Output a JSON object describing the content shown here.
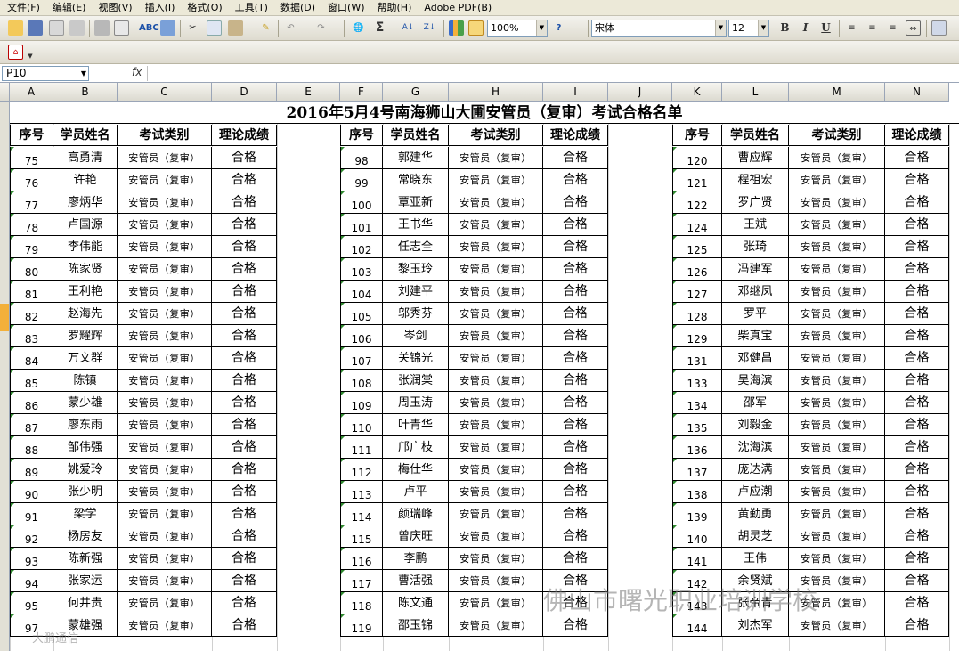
{
  "menu": [
    "文件(F)",
    "编辑(E)",
    "视图(V)",
    "插入(I)",
    "格式(O)",
    "工具(T)",
    "数据(D)",
    "窗口(W)",
    "帮助(H)",
    "Adobe PDF(B)"
  ],
  "toolbar": {
    "zoom": "100%",
    "font": "宋体",
    "size": "12",
    "bold": "B",
    "italic": "I",
    "underline": "U"
  },
  "formula": {
    "cell_ref": "P10",
    "fx": "fx",
    "value": ""
  },
  "columns": [
    "A",
    "B",
    "C",
    "D",
    "E",
    "F",
    "G",
    "H",
    "I",
    "J",
    "K",
    "L",
    "M",
    "N"
  ],
  "title": "2016年5月4号南海狮山大圃安管员（复审）考试合格名单",
  "headers": {
    "no": "序号",
    "name": "学员姓名",
    "type": "考试类别",
    "result": "理论成绩"
  },
  "type_value": "安管员（复审）",
  "result_value": "合格",
  "groups": [
    {
      "rows": [
        {
          "no": "75",
          "name": "高勇清"
        },
        {
          "no": "76",
          "name": "许艳"
        },
        {
          "no": "77",
          "name": "廖炳华"
        },
        {
          "no": "78",
          "name": "卢国源"
        },
        {
          "no": "79",
          "name": "李伟能"
        },
        {
          "no": "80",
          "name": "陈家贤"
        },
        {
          "no": "81",
          "name": "王利艳"
        },
        {
          "no": "82",
          "name": "赵海先"
        },
        {
          "no": "83",
          "name": "罗耀辉"
        },
        {
          "no": "84",
          "name": "万文群"
        },
        {
          "no": "85",
          "name": "陈镇"
        },
        {
          "no": "86",
          "name": "蒙少雄"
        },
        {
          "no": "87",
          "name": "廖东雨"
        },
        {
          "no": "88",
          "name": "邹伟强"
        },
        {
          "no": "89",
          "name": "姚爱玲"
        },
        {
          "no": "90",
          "name": "张少明"
        },
        {
          "no": "91",
          "name": "梁学"
        },
        {
          "no": "92",
          "name": "杨房友"
        },
        {
          "no": "93",
          "name": "陈新强"
        },
        {
          "no": "94",
          "name": "张家运"
        },
        {
          "no": "95",
          "name": "何井贵"
        },
        {
          "no": "97",
          "name": "蒙雄强"
        }
      ]
    },
    {
      "rows": [
        {
          "no": "98",
          "name": "郭建华"
        },
        {
          "no": "99",
          "name": "常晓东"
        },
        {
          "no": "100",
          "name": "覃亚新"
        },
        {
          "no": "101",
          "name": "王书华"
        },
        {
          "no": "102",
          "name": "任志全"
        },
        {
          "no": "103",
          "name": "黎玉玲"
        },
        {
          "no": "104",
          "name": "刘建平"
        },
        {
          "no": "105",
          "name": "邬秀芬"
        },
        {
          "no": "106",
          "name": "岑剑"
        },
        {
          "no": "107",
          "name": "关锦光"
        },
        {
          "no": "108",
          "name": "张润棠"
        },
        {
          "no": "109",
          "name": "周玉涛"
        },
        {
          "no": "110",
          "name": "叶青华"
        },
        {
          "no": "111",
          "name": "邝广枝"
        },
        {
          "no": "112",
          "name": "梅仕华"
        },
        {
          "no": "113",
          "name": "卢平"
        },
        {
          "no": "114",
          "name": "颜瑞峰"
        },
        {
          "no": "115",
          "name": "曾庆旺"
        },
        {
          "no": "116",
          "name": "李鹏"
        },
        {
          "no": "117",
          "name": "曹活强"
        },
        {
          "no": "118",
          "name": "陈文通"
        },
        {
          "no": "119",
          "name": "邵玉锦"
        }
      ]
    },
    {
      "rows": [
        {
          "no": "120",
          "name": "曹应辉"
        },
        {
          "no": "121",
          "name": "程祖宏"
        },
        {
          "no": "122",
          "name": "罗广贤"
        },
        {
          "no": "124",
          "name": "王斌"
        },
        {
          "no": "125",
          "name": "张琦"
        },
        {
          "no": "126",
          "name": "冯建军"
        },
        {
          "no": "127",
          "name": "邓继凤"
        },
        {
          "no": "128",
          "name": "罗平"
        },
        {
          "no": "129",
          "name": "柴真宝"
        },
        {
          "no": "131",
          "name": "邓健昌"
        },
        {
          "no": "133",
          "name": "吴海滨"
        },
        {
          "no": "134",
          "name": "邵军"
        },
        {
          "no": "135",
          "name": "刘毅金"
        },
        {
          "no": "136",
          "name": "沈海滨"
        },
        {
          "no": "137",
          "name": "庞达满"
        },
        {
          "no": "138",
          "name": "卢应潮"
        },
        {
          "no": "139",
          "name": "黄勤勇"
        },
        {
          "no": "140",
          "name": "胡灵芝"
        },
        {
          "no": "141",
          "name": "王伟"
        },
        {
          "no": "142",
          "name": "余贤斌"
        },
        {
          "no": "143",
          "name": "张帝青"
        },
        {
          "no": "144",
          "name": "刘杰军"
        }
      ]
    }
  ],
  "watermark": {
    "main": "佛山市曙光职业培训学校",
    "small": "大鹏通信"
  }
}
